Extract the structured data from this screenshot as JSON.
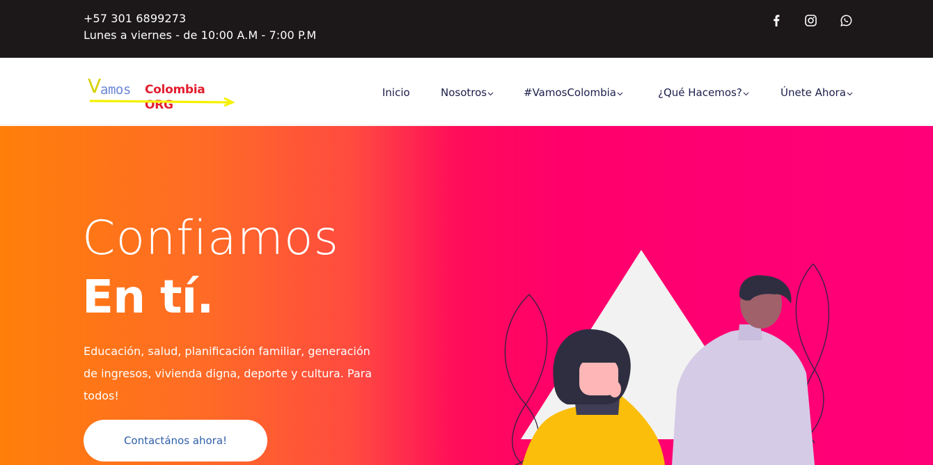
{
  "topbar": {
    "phone": "+57 301 6899273",
    "hours": "Lunes a viernes - de 10:00 A.M - 7:00 P.M",
    "social": [
      {
        "icon": "facebook-icon"
      },
      {
        "icon": "instagram-icon"
      },
      {
        "icon": "whatsapp-icon"
      }
    ]
  },
  "header": {
    "logo": {
      "v": "V",
      "amos": "amos",
      "org": "Colombia ORG",
      "colors": {
        "v": "#d7d000",
        "amos": "#6a86d6",
        "org": "#e21e2e",
        "arrow": "#f5f000"
      }
    },
    "nav": [
      {
        "label": "Inicio",
        "has_dropdown": false
      },
      {
        "label": "Nosotros",
        "has_dropdown": true
      },
      {
        "label": "#VamosColombia",
        "has_dropdown": true
      },
      {
        "label": "¿Qué Hacemos?",
        "has_dropdown": true
      },
      {
        "label": "Únete Ahora",
        "has_dropdown": true
      }
    ]
  },
  "hero": {
    "title_light": "Confiamos",
    "title_bold": "En tí.",
    "description": "Educación, salud, planificación familiar, generación de ingresos, vivienda digna, deporte y cultura. Para todos!",
    "cta_label": "Contactános ahora!",
    "colors": {
      "gradient_start": "#ff7f0a",
      "gradient_end": "#ff0078",
      "cta_text": "#2f5fa8"
    }
  }
}
